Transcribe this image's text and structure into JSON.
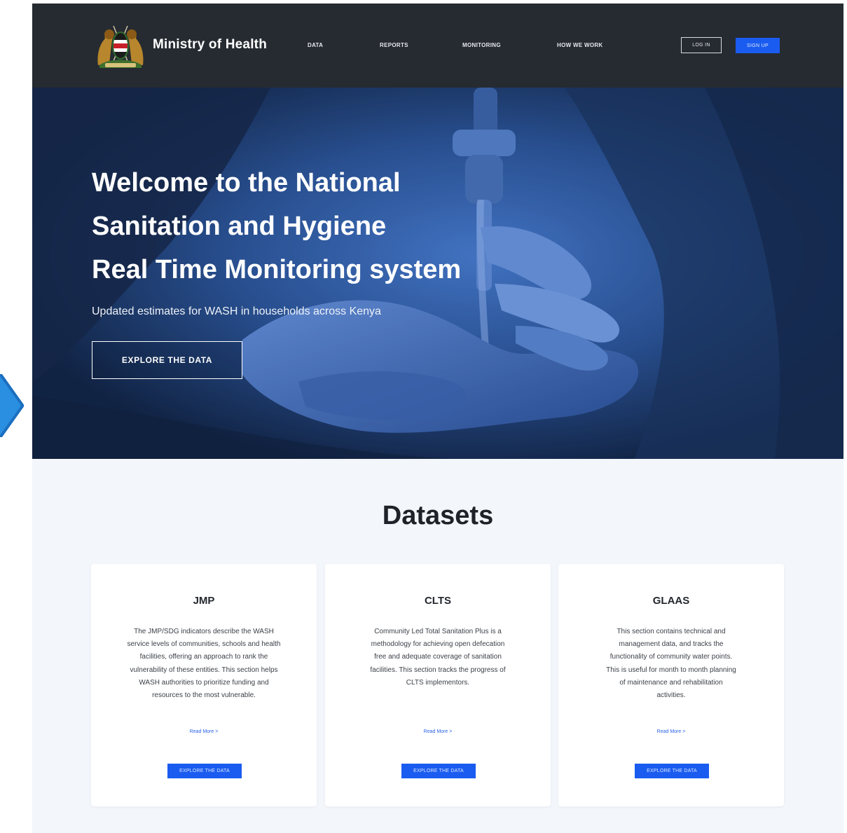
{
  "header": {
    "brand": "Ministry of Health",
    "nav": [
      "DATA",
      "REPORTS",
      "MONITORING",
      "HOW WE WORK"
    ],
    "login_label": "LOG IN",
    "signup_label": "SIGN UP"
  },
  "hero": {
    "title_lines": [
      "Welcome to  the National",
      "Sanitation  and Hygiene",
      "Real Time Monitoring system"
    ],
    "subtitle": "Updated estimates for WASH in households across Kenya",
    "cta_label": "EXPLORE THE DATA"
  },
  "datasets": {
    "heading": "Datasets",
    "cards": [
      {
        "title": "JMP",
        "body": "The JMP/SDG indicators describe the WASH service levels of communities, schools and health facilities, offering an approach to rank the vulnerability of these entities.  This section helps WASH authorities to prioritize funding and resources to the most vulnerable.",
        "link": "Read More  >",
        "button": "EXPLORE THE DATA"
      },
      {
        "title": "CLTS",
        "body": "Community Led Total Sanitation Plus is a methodology for achieving open defecation free and adequate coverage of sanitation facilities.  This section tracks the progress of CLTS implementors.",
        "link": "Read More  >",
        "button": "EXPLORE THE DATA"
      },
      {
        "title": "GLAAS",
        "body": "This section contains technical and management data, and tracks the functionality of community water points. This is useful for month to month planning of maintenance and rehabilitation activities.",
        "link": "Read More  >",
        "button": "EXPLORE THE DATA"
      }
    ]
  },
  "colors": {
    "topbar": "#262b31",
    "accent_blue": "#1a5cf0",
    "hero_tint": "#2d62b8",
    "section_bg": "#f3f6fa"
  },
  "icons": {
    "logo": "kenya-coat-of-arms-icon",
    "side_arrow": "chevron-right-icon"
  }
}
